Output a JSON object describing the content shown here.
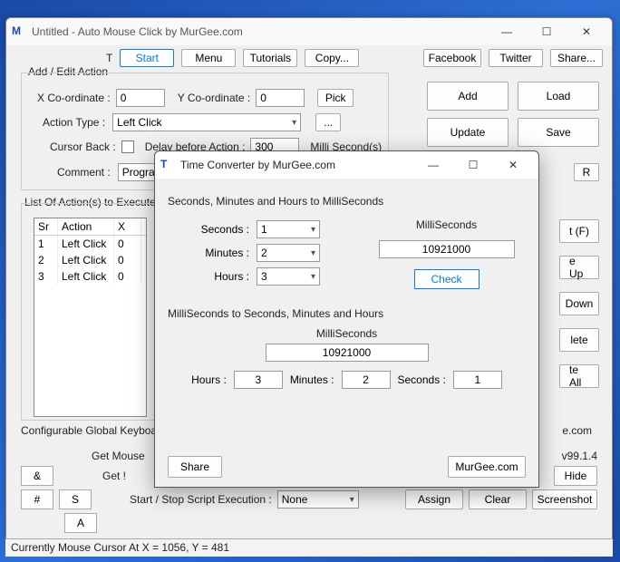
{
  "main": {
    "title": "Untitled - Auto Mouse Click by MurGee.com",
    "toolbar": {
      "t_label": "T",
      "start": "Start",
      "menu": "Menu",
      "tutorials": "Tutorials",
      "copy": "Copy...",
      "facebook": "Facebook",
      "twitter": "Twitter",
      "share": "Share...",
      "r_label": "R"
    },
    "add_edit_section": "Add / Edit Action",
    "x_label": "X Co-ordinate :",
    "x_value": "0",
    "y_label": "Y Co-ordinate :",
    "y_value": "0",
    "pick": "Pick",
    "action_type_label": "Action Type :",
    "action_type_value": "Left Click",
    "ellipsis": "...",
    "cursor_back_label": "Cursor Back :",
    "delay_label": "Delay before Action :",
    "delay_value": "300",
    "delay_unit": "Milli Second(s)",
    "comment_label": "Comment :",
    "comment_value": "Program !",
    "add": "Add",
    "load": "Load",
    "update": "Update",
    "save": "Save",
    "list_label": "List Of Action(s) to Execute i",
    "table": {
      "headers": {
        "sr": "Sr",
        "action": "Action",
        "x": "X"
      },
      "rows": [
        {
          "sr": "1",
          "action": "Left Click",
          "x": "0"
        },
        {
          "sr": "2",
          "action": "Left Click",
          "x": "0"
        },
        {
          "sr": "3",
          "action": "Left Click",
          "x": "0"
        }
      ]
    },
    "side_buttons": {
      "tf": "t (F)",
      "e_up": "e Up",
      "down": "Down",
      "lete": "lete",
      "te_all": "te All",
      "ecom": "e.com",
      "version": "v99.1.4",
      "hide": "Hide",
      "screenshot": "Screenshot"
    },
    "bottom": {
      "configurable": "Configurable Global Keyboar",
      "get_mouse": "Get Mouse",
      "get": "Get !",
      "start_stop": "Start / Stop Script Execution :",
      "none": "None",
      "assign": "Assign",
      "clear": "Clear",
      "amp": "&",
      "hash": "#",
      "s": "S",
      "a": "A"
    },
    "status": "Currently Mouse Cursor At X = 1056, Y = 481"
  },
  "dialog": {
    "title": "Time Converter by MurGee.com",
    "section1": "Seconds, Minutes and Hours to MilliSeconds",
    "seconds_label": "Seconds :",
    "seconds_value": "1",
    "minutes_label": "Minutes :",
    "minutes_value": "2",
    "hours_label": "Hours :",
    "hours_value": "3",
    "ms_label": "MilliSeconds",
    "ms_value": "10921000",
    "check": "Check",
    "section2": "MilliSeconds to Seconds, Minutes and Hours",
    "ms2_label": "MilliSeconds",
    "ms2_value": "10921000",
    "out_hours_label": "Hours :",
    "out_hours": "3",
    "out_minutes_label": "Minutes :",
    "out_minutes": "2",
    "out_seconds_label": "Seconds :",
    "out_seconds": "1",
    "share": "Share",
    "murgee": "MurGee.com"
  }
}
